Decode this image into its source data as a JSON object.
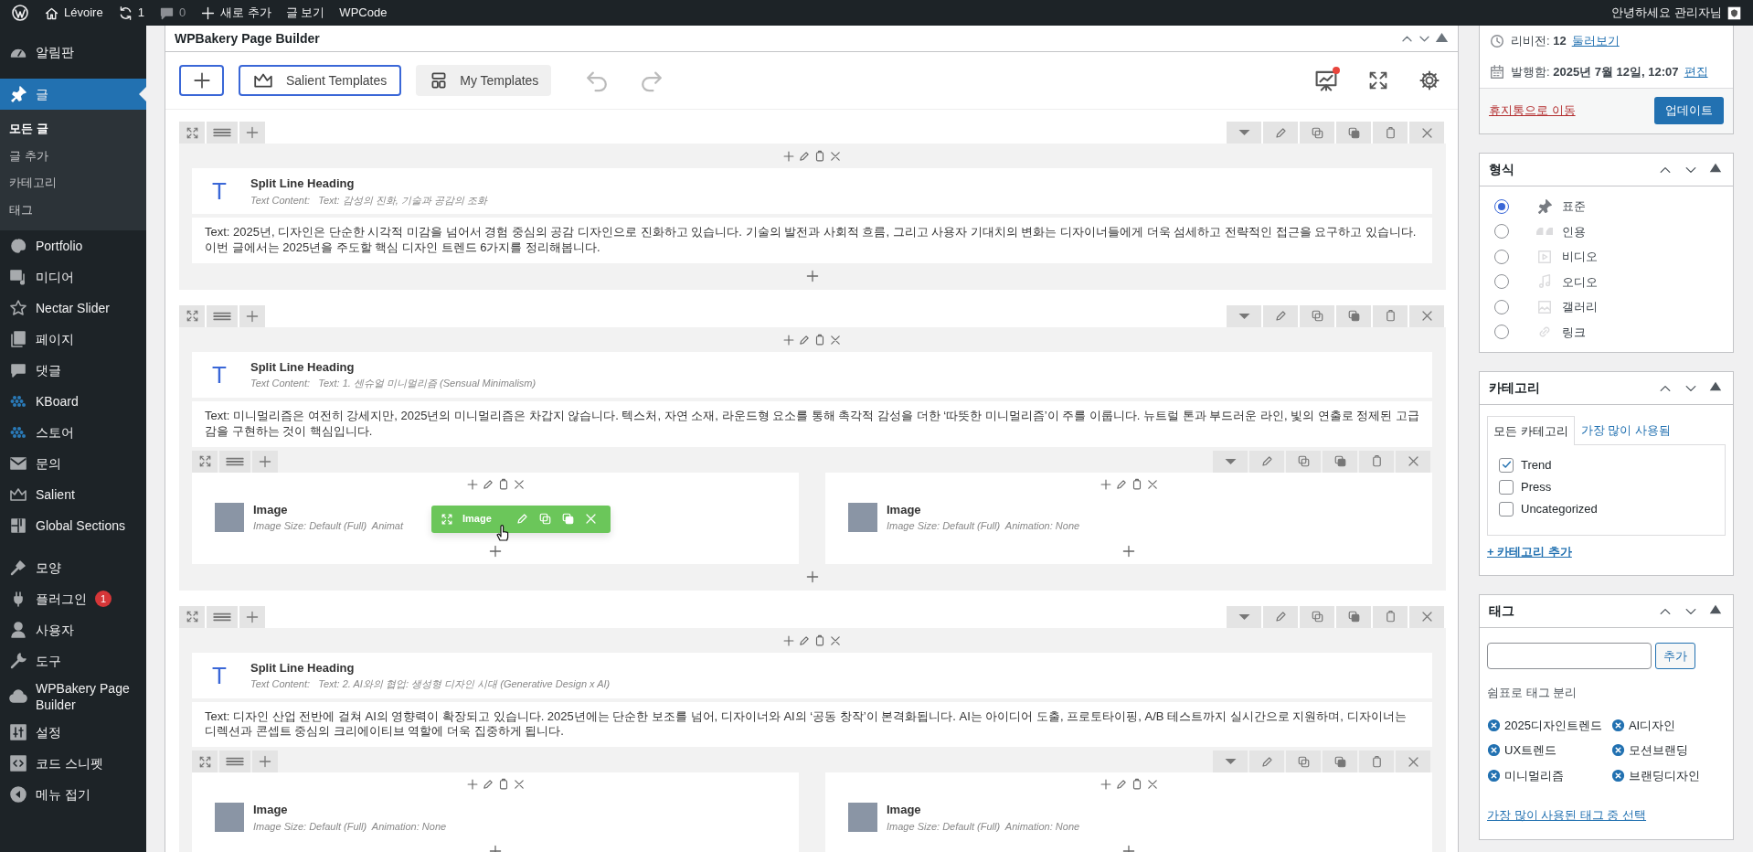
{
  "admin_bar": {
    "items": [
      {
        "kind": "wp",
        "dimmed": false
      },
      {
        "kind": "home",
        "label": "Lévoire",
        "dimmed": false
      },
      {
        "kind": "refresh",
        "label": "1",
        "dimmed": false
      },
      {
        "kind": "comment",
        "label": "0",
        "dimmed": true
      },
      {
        "kind": "plus",
        "label": "새로 추가",
        "dimmed": false
      },
      {
        "label": "글 보기",
        "dimmed": false
      },
      {
        "label": "WPCode",
        "dimmed": false
      }
    ],
    "greeting": "안녕하세요 관리자님"
  },
  "sidebar": {
    "groups": [
      [
        {
          "kind": "gauge",
          "label": "알림판",
          "selected": false
        }
      ],
      [
        {
          "kind": "pin",
          "label": "글",
          "selected": true,
          "children": [
            {
              "label": "모든 글",
              "selected": true
            },
            {
              "label": "글 추가",
              "selected": false
            },
            {
              "label": "카테고리",
              "selected": false
            },
            {
              "label": "태그",
              "selected": false
            }
          ]
        },
        {
          "kind": "palette",
          "label": "Portfolio",
          "selected": false
        },
        {
          "kind": "media",
          "label": "미디어",
          "selected": false
        },
        {
          "kind": "star",
          "label": "Nectar Slider",
          "selected": false
        },
        {
          "kind": "pages",
          "label": "페이지",
          "selected": false
        },
        {
          "kind": "comment",
          "label": "댓글",
          "selected": false
        },
        {
          "kind": "dots",
          "label": "KBoard",
          "selected": false
        },
        {
          "kind": "dots",
          "label": "스토어",
          "selected": false
        },
        {
          "kind": "envelope",
          "label": "문의",
          "selected": false
        },
        {
          "kind": "crown",
          "label": "Salient",
          "selected": false
        },
        {
          "kind": "grid",
          "label": "Global Sections",
          "selected": false
        }
      ],
      [
        {
          "kind": "brush",
          "label": "모양",
          "selected": false
        },
        {
          "kind": "plug",
          "label": "플러그인",
          "selected": false,
          "badge": "1"
        },
        {
          "kind": "person",
          "label": "사용자",
          "selected": false
        },
        {
          "kind": "wrench",
          "label": "도구",
          "selected": false
        },
        {
          "kind": "cloud",
          "label": "WPBakery Page Builder",
          "selected": false
        },
        {
          "kind": "sliders",
          "label": "설정",
          "selected": false
        },
        {
          "kind": "code",
          "label": "코드 스니펫",
          "selected": false
        },
        {
          "kind": "collapse",
          "label": "메뉴 접기",
          "selected": false
        }
      ]
    ]
  },
  "builder": {
    "title": "WPBakery Page Builder",
    "toolbar": {
      "buttons": [
        {
          "kind": "add"
        },
        {
          "kind": "outline",
          "label": "Salient Templates"
        },
        {
          "kind": "filled",
          "label": "My Templates"
        }
      ],
      "notification": true
    },
    "rows": [
      {
        "elements": [
          {
            "kind": "heading",
            "glyph": "T",
            "title": "Split Line Heading",
            "label": "Text Content:",
            "value": "Text: 감성의 진화, 기술과 공감의 조화"
          },
          {
            "kind": "text",
            "text": "Text: 2025년, 디자인은 단순한 시각적 미감을 넘어서 경험 중심의 공감 디자인으로 진화하고 있습니다. 기술의 발전과 사회적 흐름, 그리고 사용자 기대치의 변화는 디자이너들에게 더욱 섬세하고 전략적인 접근을 요구하고 있습니다. 이번 글에서는 2025년을 주도할 핵심 디자인 트렌드 6가지를 정리해봅니다."
          }
        ]
      },
      {
        "elements": [
          {
            "kind": "heading",
            "glyph": "T",
            "title": "Split Line Heading",
            "label": "Text Content:",
            "value": "Text: 1. 센슈얼 미니멀리즘 (Sensual Minimalism)"
          },
          {
            "kind": "text",
            "text": "Text: 미니멀리즘은 여전히 강세지만, 2025년의 미니멀리즘은 차갑지 않습니다. 텍스처, 자연 소재, 라운드형 요소를 통해 촉각적 감성을 더한 ‘따뜻한 미니멀리즘’이 주를 이룹니다. 뉴트럴 톤과 부드러운 라인, 빛의 연출로 정제된 고급감을 구현하는 것이 핵심입니다."
          },
          {
            "kind": "inner_row",
            "columns": [
              {
                "elements": [
                  {
                    "kind": "image",
                    "title": "Image",
                    "meta": "Image Size: Default (Full)  Animat",
                    "hovered": true,
                    "hover_label": "Image"
                  }
                ]
              },
              {
                "elements": [
                  {
                    "kind": "image",
                    "title": "Image",
                    "meta": "Image Size: Default (Full)  Animation: None",
                    "hovered": false
                  }
                ]
              }
            ]
          }
        ]
      },
      {
        "elements": [
          {
            "kind": "heading",
            "glyph": "T",
            "title": "Split Line Heading",
            "label": "Text Content:",
            "value": "Text: 2. AI와의 협업: 생성형 디자인 시대 (Generative Design x AI)"
          },
          {
            "kind": "text",
            "text": "Text: 디자인 산업 전반에 걸쳐 AI의 영향력이 확장되고 있습니다. 2025년에는 단순한 보조를 넘어, 디자이너와 AI의 ‘공동 창작’이 본격화됩니다. AI는 아이디어 도출, 프로토타이핑, A/B 테스트까지 실시간으로 지원하며, 디자이너는 디렉션과 콘셉트 중심의 크리에이티브 역할에 더욱 집중하게 됩니다."
          },
          {
            "kind": "inner_row",
            "columns": [
              {
                "elements": [
                  {
                    "kind": "image",
                    "title": "Image",
                    "meta": "Image Size: Default (Full)  Animation: None",
                    "hovered": false
                  }
                ]
              },
              {
                "elements": [
                  {
                    "kind": "image",
                    "title": "Image",
                    "meta": "Image Size: Default (Full)  Animation: None",
                    "hovered": false
                  }
                ]
              }
            ]
          }
        ]
      }
    ]
  },
  "publish": {
    "revisions": {
      "label": "리비전:",
      "value": "12",
      "link": "둘러보기"
    },
    "published": {
      "label": "발행함:",
      "value": "2025년 7월 12일, 12:07",
      "link": "편집"
    },
    "trash": "휴지통으로 이동",
    "update": "업데이트"
  },
  "format": {
    "title": "형식",
    "options": [
      {
        "kind": "pin",
        "label": "표준",
        "selected": true
      },
      {
        "kind": "quote",
        "label": "인용",
        "selected": false
      },
      {
        "kind": "video",
        "label": "비디오",
        "selected": false
      },
      {
        "kind": "audio",
        "label": "오디오",
        "selected": false
      },
      {
        "kind": "gallery",
        "label": "갤러리",
        "selected": false
      },
      {
        "kind": "link",
        "label": "링크",
        "selected": false
      }
    ]
  },
  "categories": {
    "title": "카테고리",
    "tabs": [
      {
        "label": "모든 카테고리",
        "selected": true
      },
      {
        "label": "가장 많이 사용됨",
        "selected": false
      }
    ],
    "items": [
      {
        "label": "Trend",
        "checked": true
      },
      {
        "label": "Press",
        "checked": false
      },
      {
        "label": "Uncategorized",
        "checked": false
      }
    ],
    "add_link": "+ 카테고리 추가"
  },
  "tags": {
    "title": "태그",
    "button": "추가",
    "hint": "쉼표로 태그 분리",
    "tags": [
      "2025디자인트렌드",
      "AI디자인",
      "UX트렌드",
      "모션브랜딩",
      "미니멀리즘",
      "브랜딩디자인"
    ],
    "choose_link": "가장 많이 사용된 태그 중 선택"
  }
}
